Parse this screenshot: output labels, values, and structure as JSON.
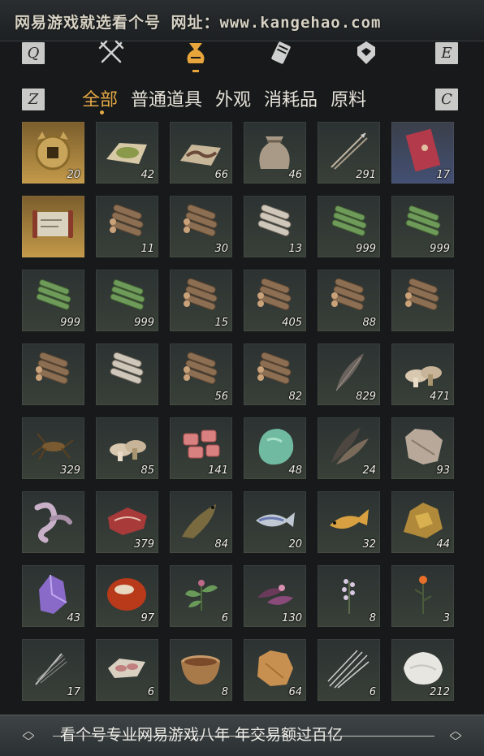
{
  "banner": {
    "text": "网易游戏就选看个号  网址：www.kangehao.com"
  },
  "keys": {
    "q": "Q",
    "e": "E",
    "z": "Z",
    "c": "C"
  },
  "tabs": [
    {
      "icon": "crossed-swords-icon",
      "active": false
    },
    {
      "icon": "pouch-icon",
      "active": true
    },
    {
      "icon": "scroll-icon",
      "active": false
    },
    {
      "icon": "tag-icon",
      "active": false
    }
  ],
  "filters": [
    "全部",
    "普通道具",
    "外观",
    "消耗品",
    "原料"
  ],
  "active_filter": "全部",
  "items": [
    {
      "icon": "coin-icon",
      "count": "20",
      "bg": "gold"
    },
    {
      "icon": "powder-icon",
      "count": "42"
    },
    {
      "icon": "worm-icon",
      "count": "66"
    },
    {
      "icon": "sack-icon",
      "count": "46"
    },
    {
      "icon": "arrow-icon",
      "count": "291"
    },
    {
      "icon": "red-book-icon",
      "count": "17",
      "bg": "red"
    },
    {
      "icon": "map-scroll-icon",
      "count": "",
      "bg": "gold"
    },
    {
      "icon": "log-pile-icon",
      "count": "11"
    },
    {
      "icon": "log-pile-icon",
      "count": "30"
    },
    {
      "icon": "birch-log-icon",
      "count": "13"
    },
    {
      "icon": "bamboo-icon",
      "count": "999"
    },
    {
      "icon": "bamboo-icon",
      "count": "999"
    },
    {
      "icon": "bamboo-icon",
      "count": "999"
    },
    {
      "icon": "bamboo-icon",
      "count": "999"
    },
    {
      "icon": "log-pile-icon",
      "count": "15"
    },
    {
      "icon": "log-pile-icon",
      "count": "405"
    },
    {
      "icon": "log-pile-icon",
      "count": "88"
    },
    {
      "icon": "log-pile-icon",
      "count": ""
    },
    {
      "icon": "log-pile-icon",
      "count": ""
    },
    {
      "icon": "birch-log-icon",
      "count": ""
    },
    {
      "icon": "log-pile-icon",
      "count": "56"
    },
    {
      "icon": "log-pile-icon",
      "count": "82"
    },
    {
      "icon": "feather-icon",
      "count": "829"
    },
    {
      "icon": "mushroom-icon",
      "count": "471"
    },
    {
      "icon": "cricket-icon",
      "count": "329"
    },
    {
      "icon": "mushroom-icon",
      "count": "85"
    },
    {
      "icon": "meat-chunks-icon",
      "count": "141"
    },
    {
      "icon": "jade-stone-icon",
      "count": "48"
    },
    {
      "icon": "feathers-icon",
      "count": "24"
    },
    {
      "icon": "fur-pelt-icon",
      "count": "93"
    },
    {
      "icon": "tendon-icon",
      "count": ""
    },
    {
      "icon": "steak-icon",
      "count": "379"
    },
    {
      "icon": "catfish-icon",
      "count": "84"
    },
    {
      "icon": "fish-icon",
      "count": "20"
    },
    {
      "icon": "carp-icon",
      "count": "32"
    },
    {
      "icon": "ore-icon",
      "count": "44"
    },
    {
      "icon": "amethyst-icon",
      "count": "43"
    },
    {
      "icon": "red-stone-icon",
      "count": "97"
    },
    {
      "icon": "herb-icon",
      "count": "6"
    },
    {
      "icon": "purple-herb-icon",
      "count": "130"
    },
    {
      "icon": "flower-icon",
      "count": "8"
    },
    {
      "icon": "orange-flower-icon",
      "count": "3"
    },
    {
      "icon": "quill-icon",
      "count": "17"
    },
    {
      "icon": "meat-slices-icon",
      "count": "6"
    },
    {
      "icon": "bowl-icon",
      "count": "8"
    },
    {
      "icon": "tan-pelt-icon",
      "count": "64"
    },
    {
      "icon": "quills-icon",
      "count": "6"
    },
    {
      "icon": "white-fur-icon",
      "count": "212"
    }
  ],
  "footer": {
    "text": "看个号专业网易游戏八年  年交易额过百亿"
  },
  "colors": {
    "accent": "#e3a845",
    "panel": "#17191a",
    "slot": "#343a36"
  }
}
